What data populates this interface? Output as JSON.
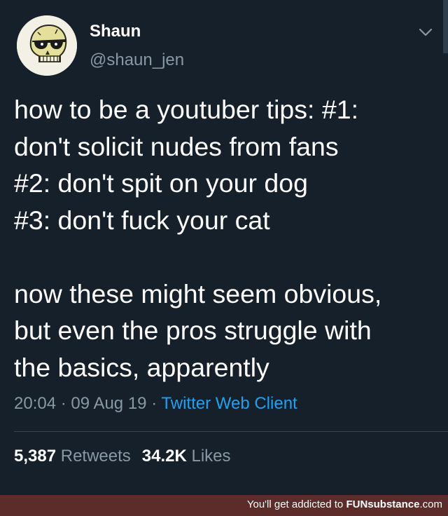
{
  "user": {
    "display_name": "Shaun",
    "handle": "@shaun_jen",
    "avatar_icon": "skull-with-sunglasses-avatar"
  },
  "menu": {
    "icon": "chevron-down-icon"
  },
  "tweet": {
    "lines_1": [
      "how to be a youtuber tips: #1:",
      "don't solicit nudes from fans",
      "#2: don't spit on your dog",
      "#3: don't fuck your cat"
    ],
    "lines_2": [
      "now these might seem obvious,",
      "but even the pros struggle with",
      "the basics, apparently"
    ]
  },
  "meta": {
    "time": "20:04",
    "separator": "·",
    "date": "09 Aug 19",
    "client": "Twitter Web Client"
  },
  "stats": {
    "retweets_count": "5,387",
    "retweets_label": "Retweets",
    "likes_count": "34.2K",
    "likes_label": "Likes"
  },
  "footer": {
    "text": "You'll get addicted to",
    "brand_part1": "FUN",
    "brand_part2": "substance",
    "brand_part3": ".com"
  },
  "colors": {
    "background": "#15202b",
    "secondary_text": "#8899a6",
    "link": "#1da1f2",
    "footer_bar": "#5b2c29"
  }
}
